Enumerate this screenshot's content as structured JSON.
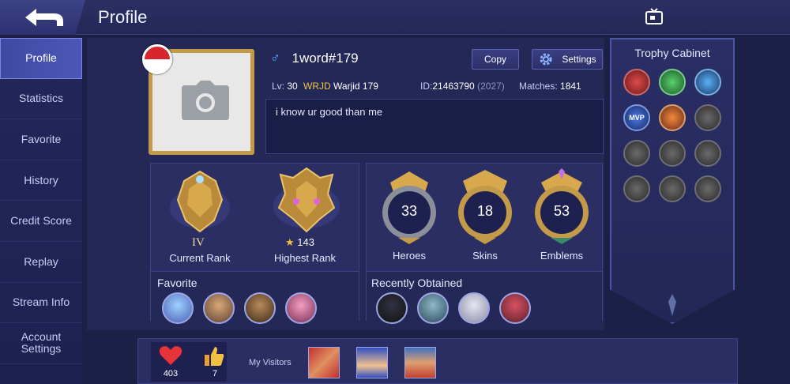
{
  "header": {
    "title": "Profile"
  },
  "sidebar": {
    "items": [
      {
        "label": "Profile"
      },
      {
        "label": "Statistics"
      },
      {
        "label": "Favorite"
      },
      {
        "label": "History"
      },
      {
        "label": "Credit Score"
      },
      {
        "label": "Replay"
      },
      {
        "label": "Stream Info"
      },
      {
        "label": "Account\nSettings"
      }
    ]
  },
  "profile": {
    "name": "1word#179",
    "gender_symbol": "♂",
    "level_label": "Lv:",
    "level": "30",
    "squad_tag": "WRJD",
    "squad_name": "Warjid 179",
    "id_label": "ID:",
    "id": "21463790",
    "server": "(2027)",
    "matches_label": "Matches:",
    "matches": "1841",
    "signature": "i know ur good than me",
    "copy_label": "Copy",
    "settings_label": "Settings"
  },
  "rank": {
    "current_tier": "IV",
    "current_label": "Current Rank",
    "highest_stars": "143",
    "highest_label": "Highest Rank"
  },
  "stats": {
    "heroes": "33",
    "heroes_label": "Heroes",
    "skins": "18",
    "skins_label": "Skins",
    "emblems": "53",
    "emblems_label": "Emblems"
  },
  "favorite_title": "Favorite",
  "recent_title": "Recently Obtained",
  "trophy": {
    "title": "Trophy Cabinet"
  },
  "bottom": {
    "likes": "403",
    "thumbs": "7",
    "visitors_label": "My Visitors"
  },
  "colors": {
    "accent_gold": "#c39a47",
    "squad": "#f0c541",
    "gender": "#56b8ff"
  }
}
